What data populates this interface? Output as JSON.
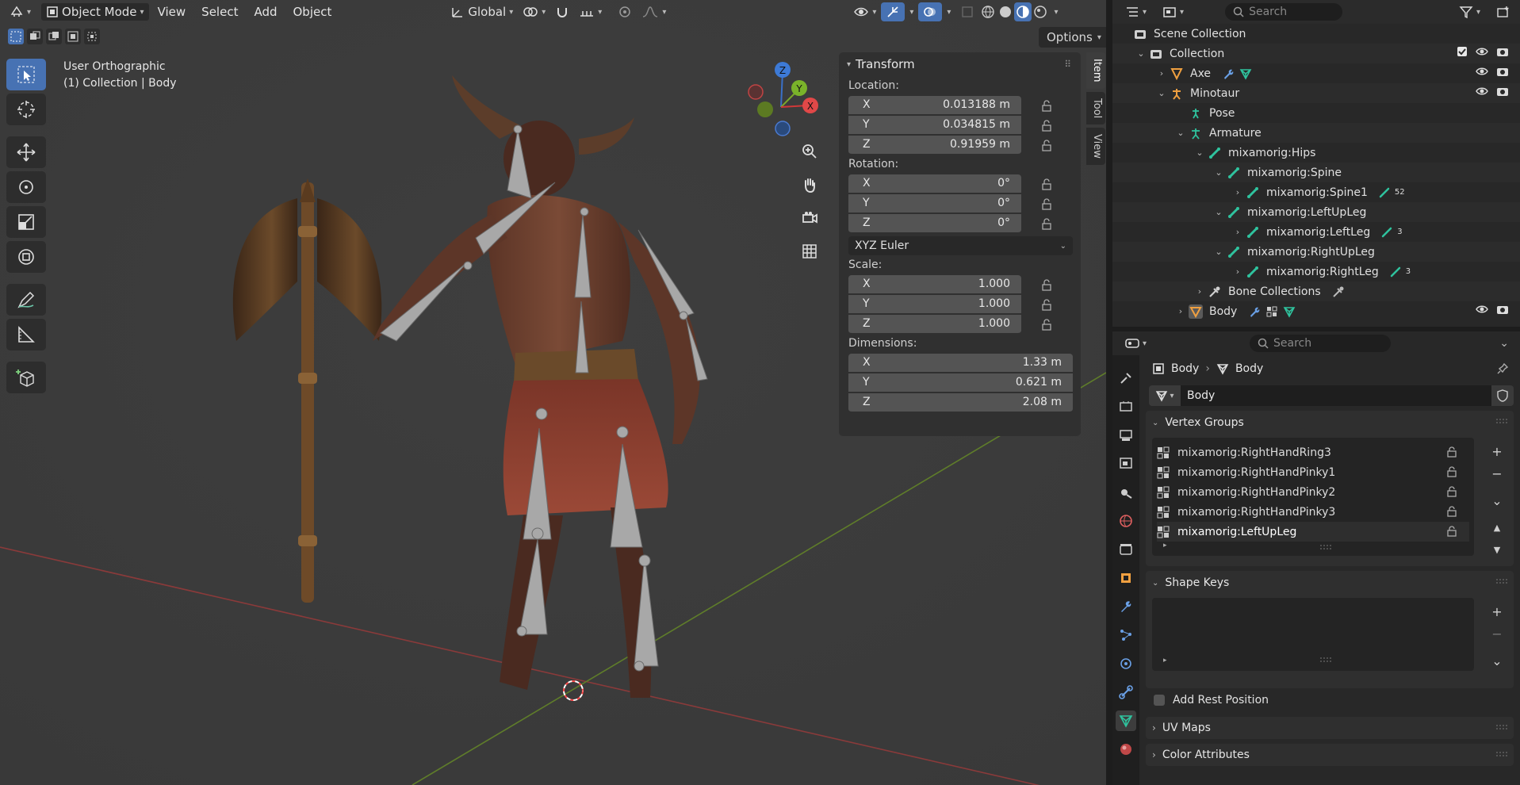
{
  "viewport": {
    "mode_label": "Object Mode",
    "menus": [
      "View",
      "Select",
      "Add",
      "Object"
    ],
    "transform_orientation": "Global",
    "options_label": "Options",
    "view_name": "User Orthographic",
    "collection_info": "(1) Collection | Body",
    "gizmo_axes": {
      "x": "X",
      "y": "Y",
      "z": "Z"
    }
  },
  "npanel": {
    "title": "Transform",
    "location_label": "Location:",
    "location": [
      {
        "axis": "X",
        "value": "0.013188 m"
      },
      {
        "axis": "Y",
        "value": "0.034815 m"
      },
      {
        "axis": "Z",
        "value": "0.91959 m"
      }
    ],
    "rotation_label": "Rotation:",
    "rotation": [
      {
        "axis": "X",
        "value": "0°"
      },
      {
        "axis": "Y",
        "value": "0°"
      },
      {
        "axis": "Z",
        "value": "0°"
      }
    ],
    "rotation_mode": "XYZ Euler",
    "scale_label": "Scale:",
    "scale": [
      {
        "axis": "X",
        "value": "1.000"
      },
      {
        "axis": "Y",
        "value": "1.000"
      },
      {
        "axis": "Z",
        "value": "1.000"
      }
    ],
    "dimensions_label": "Dimensions:",
    "dimensions": [
      {
        "axis": "X",
        "value": "1.33 m"
      },
      {
        "axis": "Y",
        "value": "0.621 m"
      },
      {
        "axis": "Z",
        "value": "2.08 m"
      }
    ],
    "tabs": [
      "Item",
      "Tool",
      "View"
    ]
  },
  "outliner": {
    "search_placeholder": "Search",
    "rows": [
      {
        "label": "Scene Collection"
      },
      {
        "label": "Collection"
      },
      {
        "label": "Axe"
      },
      {
        "label": "Minotaur"
      },
      {
        "label": "Pose"
      },
      {
        "label": "Armature"
      },
      {
        "label": "mixamorig:Hips"
      },
      {
        "label": "mixamorig:Spine"
      },
      {
        "label": "mixamorig:Spine1",
        "count": "52"
      },
      {
        "label": "mixamorig:LeftUpLeg"
      },
      {
        "label": "mixamorig:LeftLeg",
        "count": "3"
      },
      {
        "label": "mixamorig:RightUpLeg"
      },
      {
        "label": "mixamorig:RightLeg",
        "count": "3"
      },
      {
        "label": "Bone Collections"
      },
      {
        "label": "Body"
      }
    ]
  },
  "properties": {
    "search_placeholder": "Search",
    "breadcrumb": [
      "Body",
      "Body"
    ],
    "data_name": "Body",
    "vertex_groups_title": "Vertex Groups",
    "vertex_groups": [
      "mixamorig:RightHandRing3",
      "mixamorig:RightHandPinky1",
      "mixamorig:RightHandPinky2",
      "mixamorig:RightHandPinky3",
      "mixamorig:LeftUpLeg"
    ],
    "shape_keys_title": "Shape Keys",
    "add_rest_position": "Add Rest Position",
    "uv_maps_title": "UV Maps",
    "color_attributes_title": "Color Attributes"
  }
}
